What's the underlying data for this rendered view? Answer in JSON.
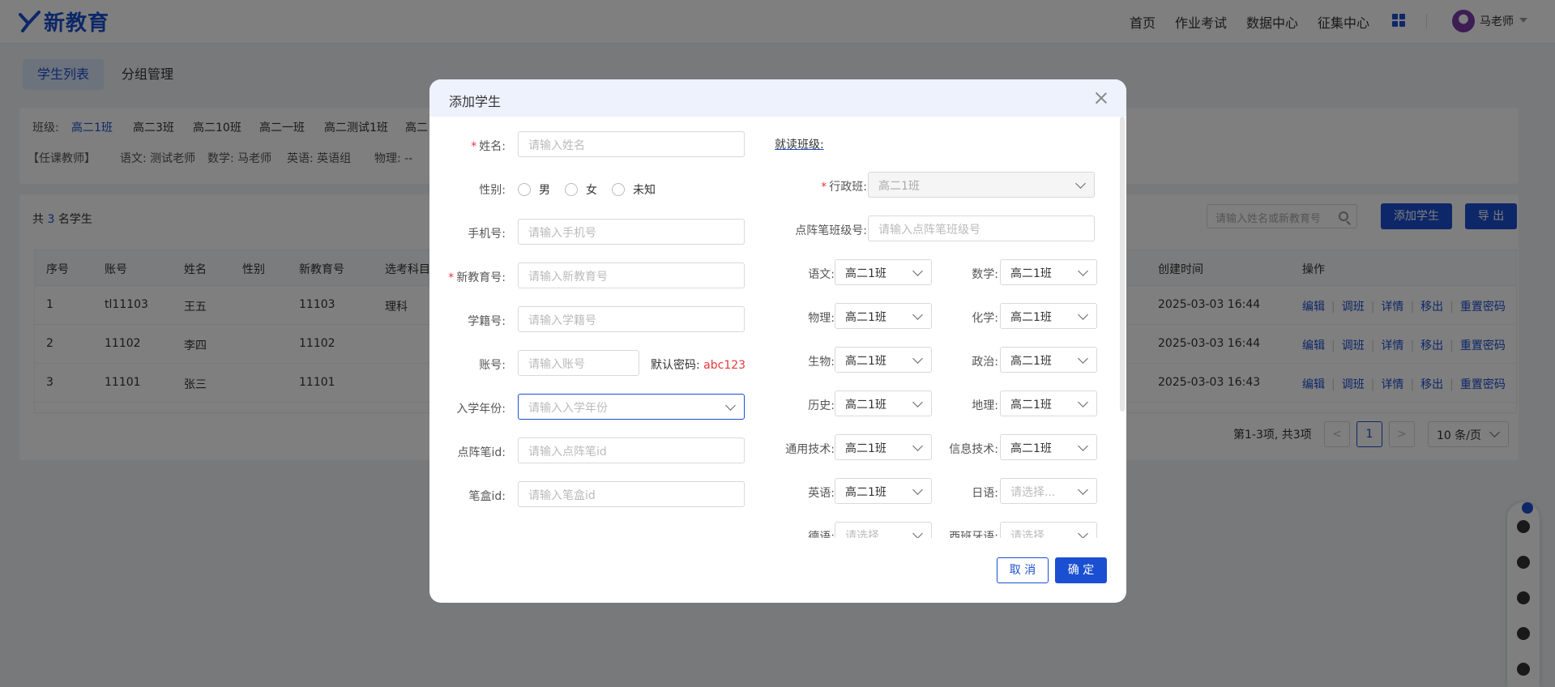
{
  "header": {
    "logo_text": "新教育",
    "nav": [
      "首页",
      "作业考试",
      "数据中心",
      "征集中心"
    ],
    "user_name": "马老师"
  },
  "tabs": [
    "学生列表",
    "分组管理"
  ],
  "filter": {
    "label": "班级:",
    "classes": [
      "高二1班",
      "高二3班",
      "高二10班",
      "高二一班",
      "高二测试1班",
      "高二"
    ],
    "teachers_prefix": "【任课教师】",
    "teachers": [
      "语文: 测试老师",
      "数学: 马老师",
      "英语: 英语组",
      "物理: --"
    ]
  },
  "list": {
    "count_prefix": "共",
    "count": "3",
    "count_suffix": "名学生",
    "search_placeholder": "请输入姓名或新教育号",
    "add_button": "添加学生",
    "export_button": "导 出",
    "columns": [
      "序号",
      "账号",
      "姓名",
      "性别",
      "新教育号",
      "选考科目",
      "创建时间",
      "操作"
    ],
    "rows": [
      {
        "no": "1",
        "account": "tl11103",
        "name": "王五",
        "gender": "",
        "id": "11103",
        "subject": "理科",
        "created": "2025-03-03 16:44"
      },
      {
        "no": "2",
        "account": "11102",
        "name": "李四",
        "gender": "",
        "id": "11102",
        "subject": "",
        "created": "2025-03-03 16:44"
      },
      {
        "no": "3",
        "account": "11101",
        "name": "张三",
        "gender": "",
        "id": "11101",
        "subject": "",
        "created": "2025-03-03 16:43"
      }
    ],
    "ops": [
      "编辑",
      "调班",
      "详情",
      "移出",
      "重置密码"
    ],
    "pager_text": "第1-3项, 共3项",
    "page_prev": "<",
    "page_current": "1",
    "page_next": ">",
    "page_size": "10 条/页"
  },
  "modal": {
    "title": "添加学生",
    "fields": {
      "name_label": "姓名:",
      "name_placeholder": "请输入姓名",
      "gender_label": "性别:",
      "gender_options": [
        "男",
        "女",
        "未知"
      ],
      "phone_label": "手机号:",
      "phone_placeholder": "请输入手机号",
      "eduid_label": "新教育号:",
      "eduid_placeholder": "请输入新教育号",
      "xueji_label": "学籍号:",
      "xueji_placeholder": "请输入学籍号",
      "account_label": "账号:",
      "account_placeholder": "请输入账号",
      "pw_prefix": "默认密码:",
      "pw_value": "abc123",
      "year_label": "入学年份:",
      "year_placeholder": "请输入入学年份",
      "pen_label": "点阵笔id:",
      "pen_placeholder": "请输入点阵笔id",
      "box_label": "笔盒id:",
      "box_placeholder": "请输入笔盒id"
    },
    "classes_section": {
      "title": "就读班级:",
      "admin_label": "行政班:",
      "admin_value": "高二1班",
      "penclass_label": "点阵笔班级号:",
      "penclass_placeholder": "请输入点阵笔班级号",
      "subjects": [
        {
          "label": "语文:",
          "value": "高二1班"
        },
        {
          "label": "数学:",
          "value": "高二1班"
        },
        {
          "label": "物理:",
          "value": "高二1班"
        },
        {
          "label": "化学:",
          "value": "高二1班"
        },
        {
          "label": "生物:",
          "value": "高二1班"
        },
        {
          "label": "政治:",
          "value": "高二1班"
        },
        {
          "label": "历史:",
          "value": "高二1班"
        },
        {
          "label": "地理:",
          "value": "高二1班"
        },
        {
          "label": "通用技术:",
          "value": "高二1班"
        },
        {
          "label": "信息技术:",
          "value": "高二1班"
        },
        {
          "label": "英语:",
          "value": "高二1班"
        },
        {
          "label": "日语:",
          "value": "请选择..."
        },
        {
          "label": "德语:",
          "value": "请选择"
        },
        {
          "label": "西班牙语:",
          "value": "请选择"
        }
      ]
    },
    "cancel": "取 消",
    "ok": "确 定"
  }
}
